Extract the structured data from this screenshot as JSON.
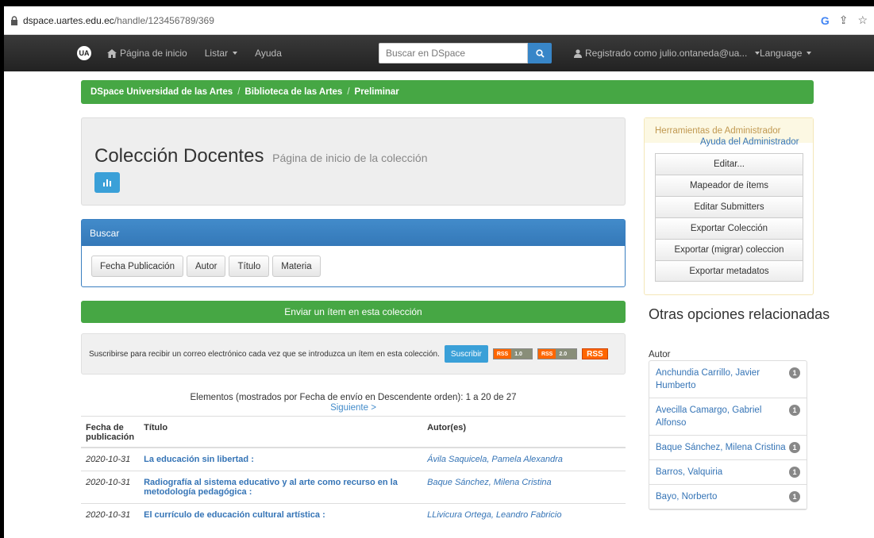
{
  "browser": {
    "url_host": "dspace.uartes.edu.ec",
    "url_path": "/handle/123456789/369"
  },
  "navbar": {
    "logo_text": "UA",
    "home": "Página de inicio",
    "list": "Listar",
    "help": "Ayuda",
    "search_placeholder": "Buscar en DSpace",
    "user": "Registrado como julio.ontaneda@ua...",
    "language": "Language"
  },
  "breadcrumb": {
    "items": [
      "DSpace Universidad de las Artes",
      "Biblioteca de las Artes",
      "Preliminar"
    ]
  },
  "collection": {
    "title": "Colección Docentes",
    "subtitle": "Página de inicio de la colección"
  },
  "search_panel": {
    "heading": "Buscar",
    "buttons": [
      "Fecha Publicación",
      "Autor",
      "Título",
      "Materia"
    ]
  },
  "submit_bar": "Enviar un ítem en esta colección",
  "subscribe": {
    "text": "Suscribirse para recibir un correo electrónico cada vez que se introduzca un ítem en esta colección.",
    "button": "Suscribir",
    "rss1_left": "RSS",
    "rss1_right": "1.0",
    "rss2_left": "RSS",
    "rss2_right": "2.0",
    "rss_main": "RSS"
  },
  "listing": {
    "info": "Elementos (mostrados por Fecha de envío en Descendente orden): 1 a 20 de 27",
    "next": "Siguiente >",
    "headers": {
      "date": "Fecha de publicación",
      "title": "Título",
      "author": "Autor(es)"
    },
    "rows": [
      {
        "date": "2020-10-31",
        "title": "La educación sin libertad :",
        "author": "Ávila Saquicela, Pamela Alexandra"
      },
      {
        "date": "2020-10-31",
        "title": "Radiografía al sistema educativo y al arte como recurso en la metodología pedagógica :",
        "author": "Baque Sánchez, Milena Cristina"
      },
      {
        "date": "2020-10-31",
        "title": "El currículo de educación cultural artística :",
        "author": "LLivicura Ortega, Leandro Fabricio"
      }
    ]
  },
  "admin": {
    "heading": "Herramientas de Administrador",
    "help": "Ayuda del Administrador",
    "buttons": [
      "Editar...",
      "Mapeador de ítems",
      "Editar Submitters",
      "Exportar Colección",
      "Exportar (migrar) coleccion",
      "Exportar metadatos"
    ]
  },
  "sidebar": {
    "title": "Otras opciones relacionadas",
    "facet_label": "Autor",
    "facets": [
      {
        "name": "Anchundia Carrillo, Javier Humberto",
        "count": "1"
      },
      {
        "name": "Avecilla Camargo, Gabriel Alfonso",
        "count": "1"
      },
      {
        "name": "Baque Sánchez, Milena Cristina",
        "count": "1"
      },
      {
        "name": "Barros, Valquiria",
        "count": "1"
      },
      {
        "name": "Bayo, Norberto",
        "count": "1"
      }
    ]
  },
  "colors": {
    "green": "#46a744",
    "blue": "#3a7fc1",
    "link": "#3574b6",
    "navbar": "#2b2b2b"
  }
}
